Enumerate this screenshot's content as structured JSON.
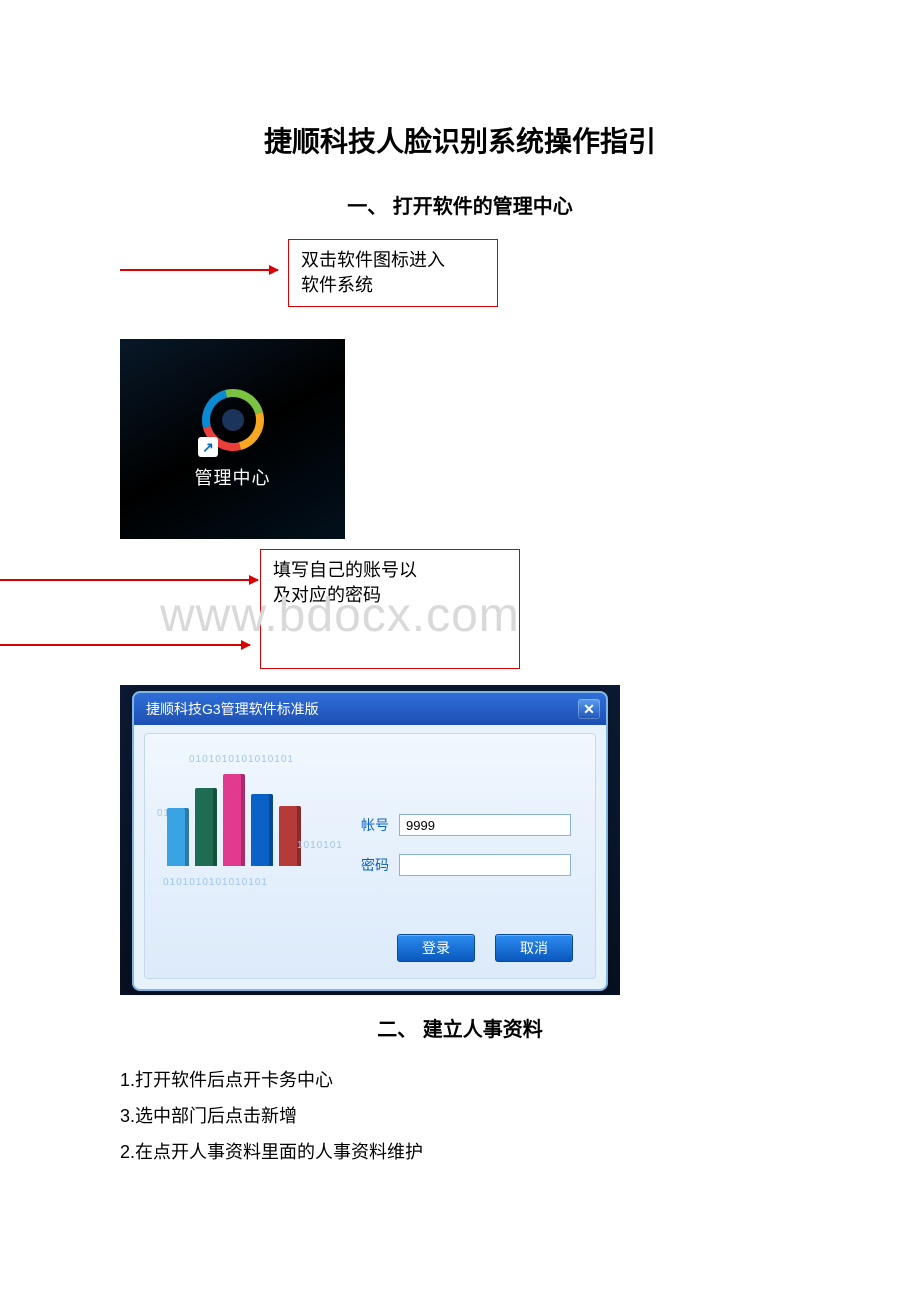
{
  "title": "捷顺科技人脸识别系统操作指引",
  "section1": {
    "heading": "一、 打开软件的管理中心",
    "callout1_line1": "双击软件图标进入",
    "callout1_line2": "软件系统",
    "desktop_icon_label": "管理中心",
    "shortcut_arrow": "↗",
    "callout2_line1": "填写自己的账号以",
    "callout2_line2": "及对应的密码"
  },
  "watermark": "www.bdocx.com",
  "login": {
    "window_title": "捷顺科技G3管理软件标准版",
    "close_glyph": "✕",
    "binary_top": "0101010101010101",
    "binary_left": "010",
    "binary_right": "1010101",
    "binary_bottom": "0101010101010101",
    "account_label": "帐号",
    "account_value": "9999",
    "password_label": "密码",
    "password_value": "",
    "login_btn": "登录",
    "cancel_btn": "取消"
  },
  "section2": {
    "heading": "二、 建立人事资料",
    "step1": "1.打开软件后点开卡务中心",
    "step2": "3.选中部门后点击新增",
    "step3": "2.在点开人事资料里面的人事资料维护"
  }
}
